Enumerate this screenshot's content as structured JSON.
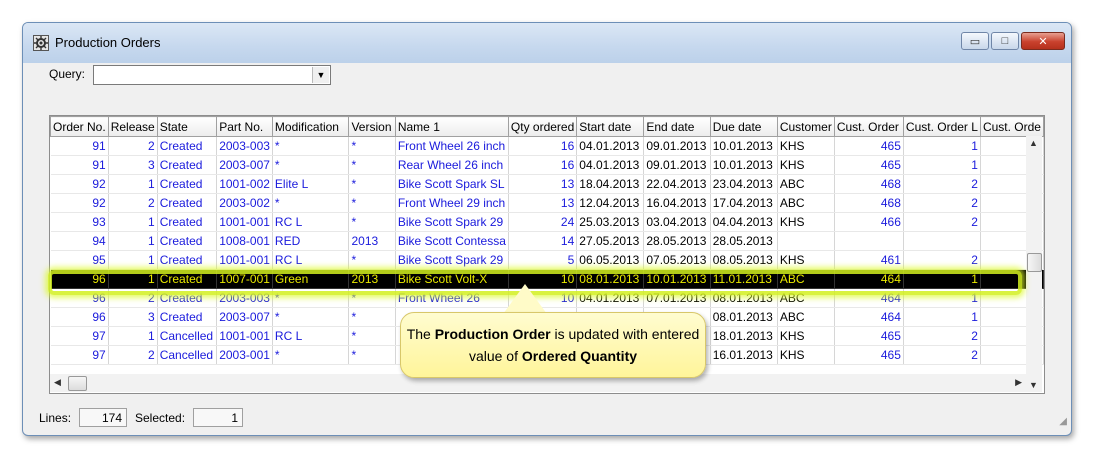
{
  "window": {
    "title": "Production Orders",
    "buttons": {
      "minimize": "▭",
      "maximize": "□",
      "close": "✕"
    }
  },
  "query": {
    "label": "Query:",
    "value": ""
  },
  "grid": {
    "columns": [
      "Order No.",
      "Release",
      "State",
      "Part No.",
      "Modification",
      "Version",
      "Name 1",
      "Qty ordered",
      "Start date",
      "End date",
      "Due date",
      "Customer",
      "Cust. Order",
      "Cust. Order L",
      "Cust. Orde"
    ],
    "rows": [
      [
        "91",
        "2",
        "Created",
        "2003-003",
        "*",
        "*",
        "Front Wheel 26 inch",
        "16",
        "04.01.2013",
        "09.01.2013",
        "10.01.2013",
        "KHS",
        "465",
        "1",
        ""
      ],
      [
        "91",
        "3",
        "Created",
        "2003-007",
        "*",
        "*",
        "Rear Wheel 26 inch",
        "16",
        "04.01.2013",
        "09.01.2013",
        "10.01.2013",
        "KHS",
        "465",
        "1",
        ""
      ],
      [
        "92",
        "1",
        "Created",
        "1001-002",
        "Elite L",
        "*",
        "Bike Scott Spark SL",
        "13",
        "18.04.2013",
        "22.04.2013",
        "23.04.2013",
        "ABC",
        "468",
        "2",
        ""
      ],
      [
        "92",
        "2",
        "Created",
        "2003-002",
        "*",
        "*",
        "Front Wheel 29 inch",
        "13",
        "12.04.2013",
        "16.04.2013",
        "17.04.2013",
        "ABC",
        "468",
        "2",
        ""
      ],
      [
        "93",
        "1",
        "Created",
        "1001-001",
        "RC L",
        "*",
        "Bike Scott Spark 29",
        "24",
        "25.03.2013",
        "03.04.2013",
        "04.04.2013",
        "KHS",
        "466",
        "2",
        ""
      ],
      [
        "94",
        "1",
        "Created",
        "1008-001",
        "RED",
        "2013",
        "Bike Scott Contessa",
        "14",
        "27.05.2013",
        "28.05.2013",
        "28.05.2013",
        "",
        "",
        "",
        ""
      ],
      [
        "95",
        "1",
        "Created",
        "1001-001",
        "RC L",
        "*",
        "Bike Scott Spark 29",
        "5",
        "06.05.2013",
        "07.05.2013",
        "08.05.2013",
        "KHS",
        "461",
        "2",
        ""
      ],
      [
        "96",
        "1",
        "Created",
        "1007-001",
        "Green",
        "2013",
        "Bike Scott Volt-X",
        "10",
        "08.01.2013",
        "10.01.2013",
        "11.01.2013",
        "ABC",
        "464",
        "1",
        ""
      ],
      [
        "96",
        "2",
        "Created",
        "2003-003",
        "*",
        "*",
        "Front Wheel 26",
        "10",
        "04.01.2013",
        "07.01.2013",
        "08.01.2013",
        "ABC",
        "464",
        "1",
        ""
      ],
      [
        "96",
        "3",
        "Created",
        "2003-007",
        "*",
        "*",
        "",
        "",
        "",
        "",
        "08.01.2013",
        "ABC",
        "464",
        "1",
        ""
      ],
      [
        "97",
        "1",
        "Cancelled",
        "1001-001",
        "RC L",
        "*",
        "",
        "",
        "",
        "",
        "18.01.2013",
        "KHS",
        "465",
        "2",
        ""
      ],
      [
        "97",
        "2",
        "Cancelled",
        "2003-001",
        "*",
        "*",
        "",
        "",
        "",
        "",
        "16.01.2013",
        "KHS",
        "465",
        "2",
        ""
      ]
    ],
    "selected_row_index": 7
  },
  "callout": {
    "part1": "The ",
    "bold1": "Production  Order",
    "part2": " is updated with entered value of ",
    "bold2": "Ordered Quantity"
  },
  "status": {
    "lines_label": "Lines:",
    "lines_value": "174",
    "selected_label": "Selected:",
    "selected_value": "1"
  },
  "colors": {
    "link_text": "#1a1adc",
    "selected_bg": "#000000",
    "selected_text": "#e8e800",
    "highlight": "#d2f01e",
    "callout_bg": "#fff59a"
  }
}
